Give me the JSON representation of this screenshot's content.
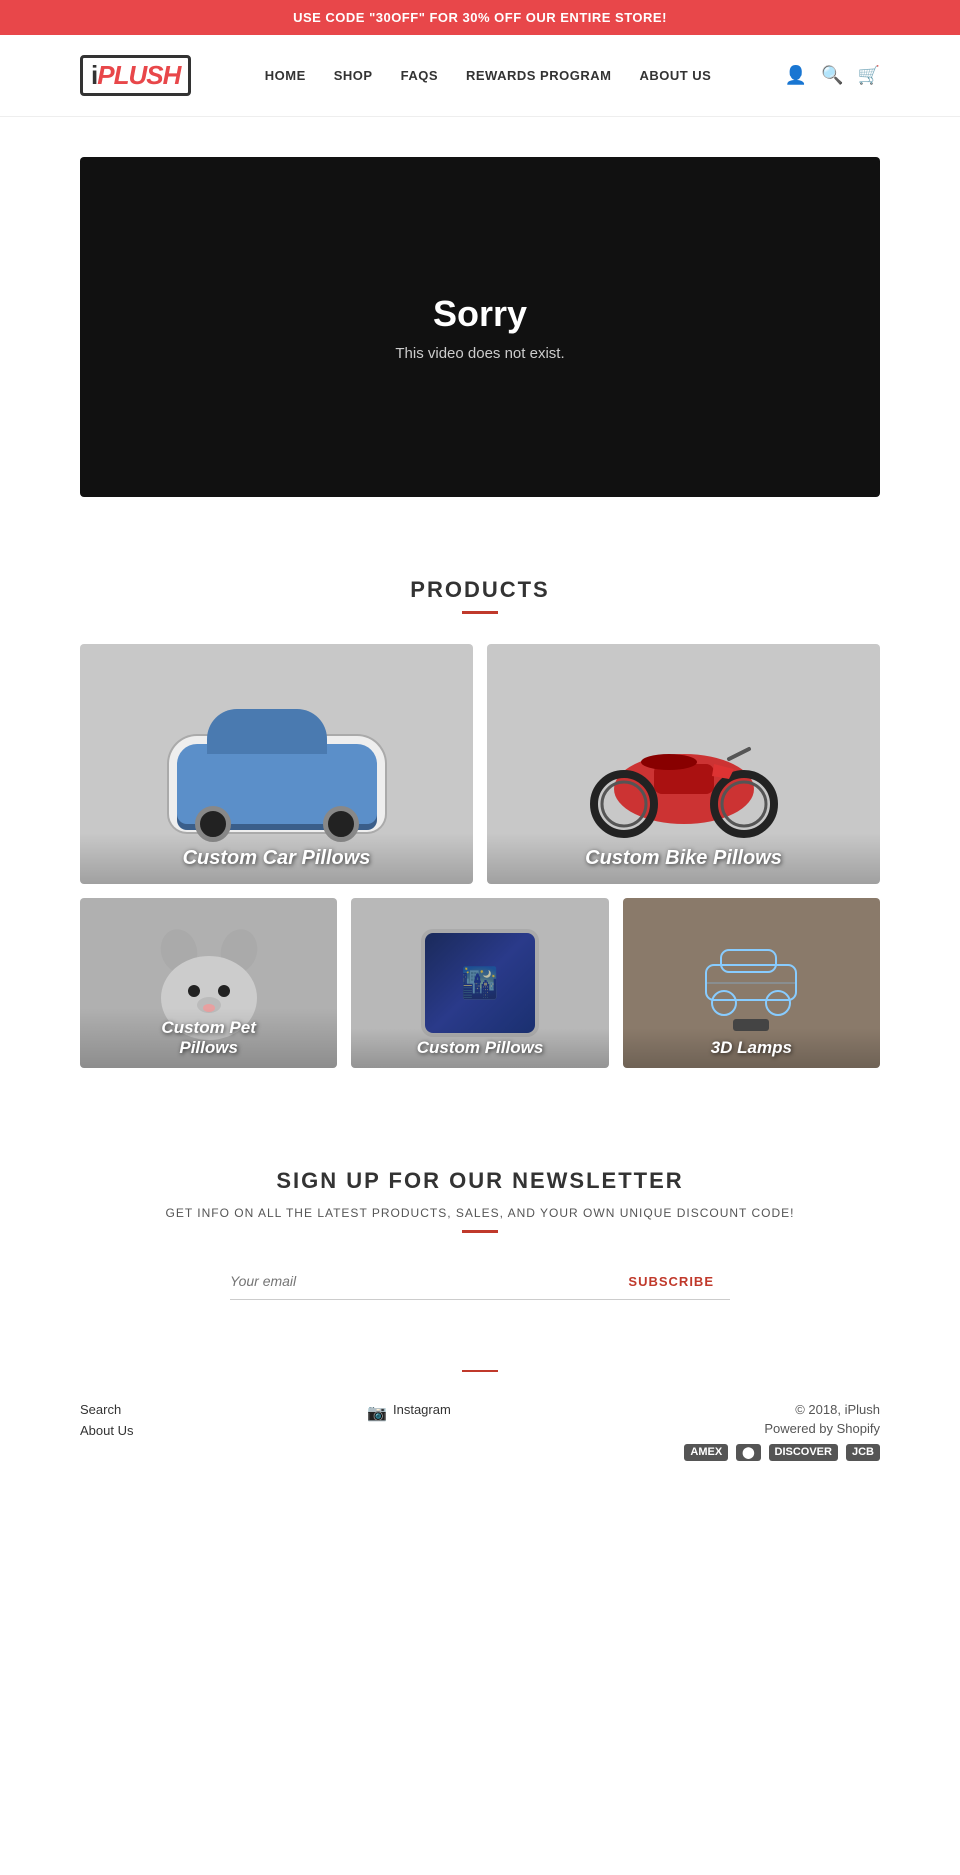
{
  "banner": {
    "text": "USE CODE \"30OFF\" FOR 30% OFF OUR ENTIRE STORE!"
  },
  "header": {
    "logo": "iPLUSH",
    "nav": {
      "home": "HOME",
      "shop": "SHOP",
      "faqs": "FAQS",
      "rewards": "REWARDS PROGRAM",
      "about": "ABOUT US"
    }
  },
  "video": {
    "sorry_text": "Sorry",
    "sub_text": "This video does not exist."
  },
  "products": {
    "title": "PRODUCTS",
    "items": [
      {
        "label": "Custom Car Pillows",
        "type": "car"
      },
      {
        "label": "Custom Bike Pillows",
        "type": "bike"
      },
      {
        "label": "Custom Pet\nPillows",
        "type": "pet"
      },
      {
        "label": "Custom Pillows",
        "type": "pillows"
      },
      {
        "label": "3D Lamps",
        "type": "lamps"
      }
    ]
  },
  "newsletter": {
    "title": "SIGN UP FOR OUR NEWSLETTER",
    "subtitle": "GET INFO ON ALL THE LATEST PRODUCTS, SALES, AND YOUR OWN UNIQUE DISCOUNT CODE!",
    "email_placeholder": "Your email",
    "subscribe_label": "SUBSCRIBE"
  },
  "footer": {
    "links": {
      "search": "Search",
      "about": "About Us"
    },
    "social": "Instagram",
    "copyright": "© 2018, iPlush",
    "powered": "Powered by Shopify",
    "payment_methods": [
      "AMEX",
      "Diners",
      "DISCOVER",
      "JCB"
    ]
  }
}
